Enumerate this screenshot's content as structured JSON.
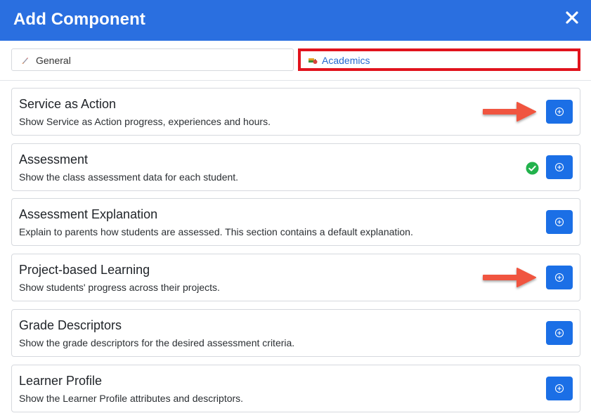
{
  "dialog": {
    "title": "Add Component",
    "close_icon": "close-icon"
  },
  "tabs": [
    {
      "label": "General",
      "icon": "rocket-icon",
      "selected": false
    },
    {
      "label": "Academics",
      "icon": "book-apple-icon",
      "selected": true
    }
  ],
  "components": [
    {
      "title": "Service as Action",
      "description": "Show Service as Action progress, experiences and hours.",
      "added": false,
      "highlighted": true
    },
    {
      "title": "Assessment",
      "description": "Show the class assessment data for each student.",
      "added": true,
      "highlighted": false
    },
    {
      "title": "Assessment Explanation",
      "description": "Explain to parents how students are assessed. This section contains a default explanation.",
      "added": false,
      "highlighted": false
    },
    {
      "title": "Project-based Learning",
      "description": "Show students' progress across their projects.",
      "added": false,
      "highlighted": true
    },
    {
      "title": "Grade Descriptors",
      "description": "Show the grade descriptors for the desired assessment criteria.",
      "added": false,
      "highlighted": false
    },
    {
      "title": "Learner Profile",
      "description": "Show the Learner Profile attributes and descriptors.",
      "added": false,
      "highlighted": false
    }
  ],
  "colors": {
    "header": "#2a6fe0",
    "button": "#1b6fe6",
    "highlight_box": "#e1131d",
    "arrow": "#f0553f",
    "check": "#22b24c",
    "active_tab_text": "#2468cf"
  }
}
